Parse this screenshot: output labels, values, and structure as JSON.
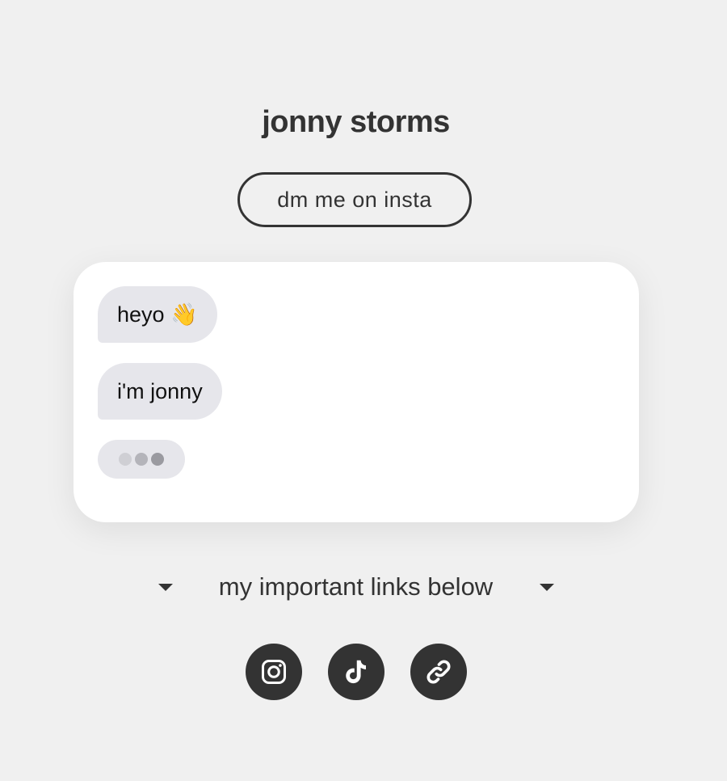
{
  "profile": {
    "name": "jonny storms"
  },
  "cta": {
    "label": "dm me on insta"
  },
  "chat": {
    "messages": [
      {
        "text": "heyo 👋"
      },
      {
        "text": "i'm jonny"
      }
    ],
    "typing_indicator": true
  },
  "links_section": {
    "heading": "my important links below"
  },
  "social_links": [
    {
      "icon": "instagram-icon"
    },
    {
      "icon": "tiktok-icon"
    },
    {
      "icon": "link-icon"
    }
  ],
  "colors": {
    "background": "#f0f0f0",
    "text": "#333333",
    "bubble": "#e6e6eb",
    "card": "#ffffff"
  }
}
